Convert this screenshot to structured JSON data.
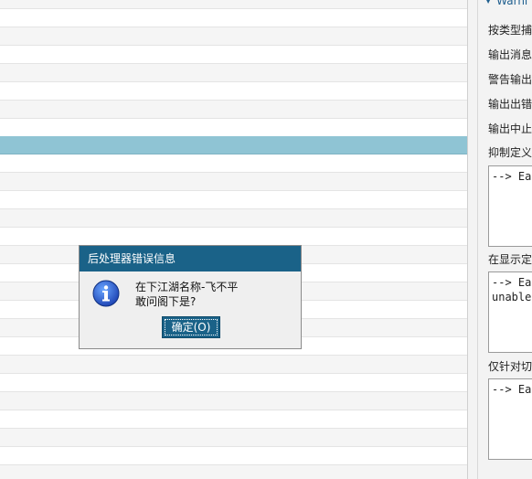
{
  "panel": {
    "section_header": "Warni",
    "labels": [
      "按类型捕",
      "输出消息",
      "警告输出",
      "输出出错",
      "输出中止",
      "抑制定义",
      "在显示定",
      "仅针对切"
    ],
    "box1_text": "--> Each",
    "box2_text": "--> Each\nunable t",
    "box3_text": "--> Each"
  },
  "dialog": {
    "title": "后处理器错误信息",
    "message_line1": "在下江湖名称-飞不平",
    "message_line2": "敢问阁下是?",
    "ok_label": "确定(O)",
    "icon": "info-icon"
  },
  "colors": {
    "title_bar": "#1a6288",
    "selected_row": "#8fc4d4",
    "panel_header": "#1f5f8f"
  }
}
